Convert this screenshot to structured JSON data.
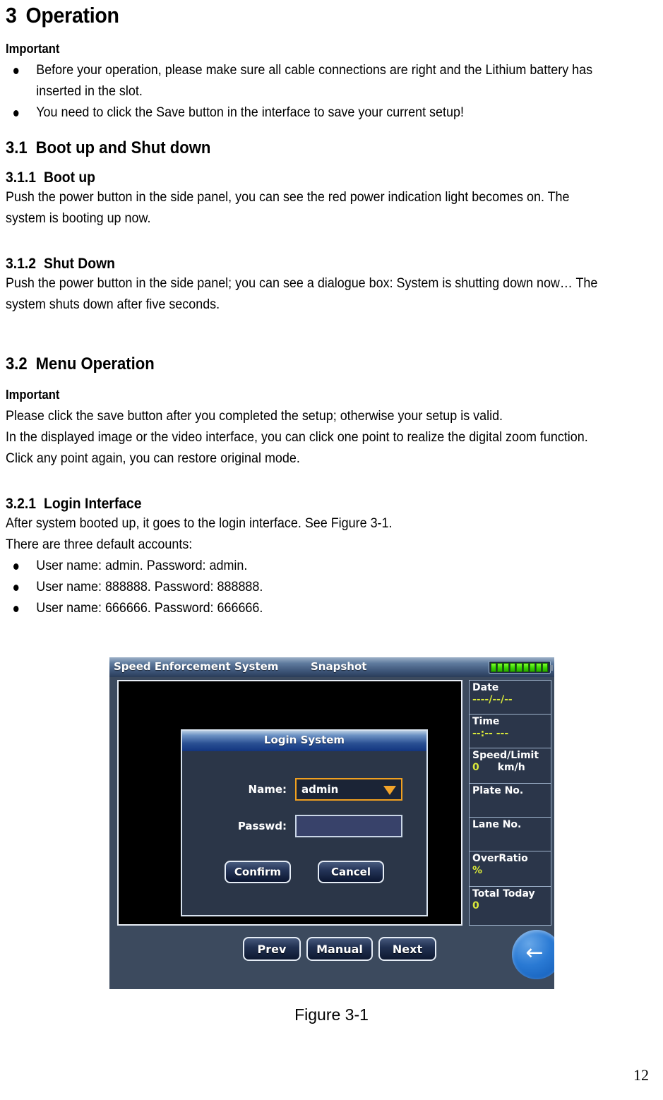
{
  "document": {
    "section_3": {
      "number": "3",
      "title": "Operation",
      "important_label": "Important",
      "bullets": [
        "Before your operation, please make sure all cable connections are right and the Lithium battery has inserted in the slot.",
        "You need to click the Save button in the interface to save your current setup!"
      ]
    },
    "section_3_1": {
      "number": "3.1",
      "title": "Boot up and Shut down"
    },
    "section_3_1_1": {
      "number": "3.1.1",
      "title": "Boot up",
      "body": "Push the power button in the side panel, you can see the red power indication light becomes on. The system is booting up now."
    },
    "section_3_1_2": {
      "number": "3.1.2",
      "title": "Shut Down",
      "body": "Push the power button in the side panel; you can see a dialogue box: System is shutting down now… The system shuts down after five seconds."
    },
    "section_3_2": {
      "number": "3.2",
      "title": "Menu Operation",
      "important_label": "Important",
      "body_line_1": "Please click the save button after you completed the setup; otherwise your setup is valid.",
      "body_line_2": "In the displayed image or the video interface, you can click one point to realize the digital zoom function. Click any point again, you can restore original mode."
    },
    "section_3_2_1": {
      "number": "3.2.1",
      "title": "Login Interface",
      "body_line_1": "After system booted up, it goes to the login interface. See Figure 3-1.",
      "body_line_2": "There are three default accounts:",
      "accounts": [
        "User name: admin. Password: admin.",
        "User name: 888888. Password: 888888.",
        "User name: 666666. Password: 666666."
      ]
    },
    "figure_caption": "Figure 3-1",
    "page_number": "12"
  },
  "figure": {
    "titlebar": {
      "app_title": "Speed Enforcement System",
      "mode_title": "Snapshot",
      "battery_icon": "battery-full-icon",
      "battery_cells": 9
    },
    "info_panel": [
      {
        "label": "Date",
        "value": "----/--/--",
        "unit": ""
      },
      {
        "label": "Time",
        "value": "--:-- ---",
        "unit": ""
      },
      {
        "label": "Speed/Limit",
        "value": "0",
        "unit": "km/h"
      },
      {
        "label": "Plate No.",
        "value": "",
        "unit": ""
      },
      {
        "label": "Lane No.",
        "value": "",
        "unit": ""
      },
      {
        "label": "OverRatio",
        "value": "%",
        "unit": ""
      },
      {
        "label": "Total Today",
        "value": "0",
        "unit": ""
      }
    ],
    "bottom_bar": {
      "prev_label": "Prev",
      "manual_label": "Manual",
      "next_label": "Next",
      "back_icon": "back-arrow-icon",
      "back_glyph": "←"
    },
    "login_dialog": {
      "title": "Login System",
      "name_label": "Name:",
      "name_value": "admin",
      "name_dropdown_icon": "chevron-down-icon",
      "passwd_label": "Passwd:",
      "passwd_value": "",
      "confirm_label": "Confirm",
      "cancel_label": "Cancel"
    },
    "colors": {
      "accent_orange": "#f0a020",
      "value_yellow": "#d9e83a",
      "panel_blue": "#2b3648",
      "battery_green": "#36d400"
    }
  }
}
